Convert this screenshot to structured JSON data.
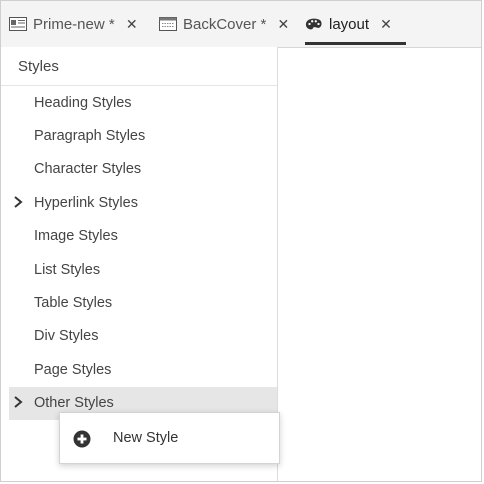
{
  "tabs": [
    {
      "label": "Prime-new *",
      "icon": "document-icon",
      "close": "✕"
    },
    {
      "label": "BackCover *",
      "icon": "page-layout-icon",
      "close": "✕"
    },
    {
      "label": "layout",
      "icon": "palette-icon",
      "close": "✕",
      "active": true
    }
  ],
  "panel": {
    "title": "Styles",
    "items": [
      {
        "label": "Heading Styles"
      },
      {
        "label": "Paragraph Styles"
      },
      {
        "label": "Character Styles"
      },
      {
        "label": "Hyperlink Styles",
        "expandable": true,
        "chevron": "›"
      },
      {
        "label": "Image Styles"
      },
      {
        "label": "List Styles"
      },
      {
        "label": "Table Styles"
      },
      {
        "label": "Div Styles"
      },
      {
        "label": "Page Styles"
      },
      {
        "label": "Other Styles",
        "expandable": true,
        "chevron": "›",
        "selected": true
      }
    ]
  },
  "context_menu": {
    "items": [
      {
        "label": "New Style",
        "icon": "plus-circle-icon"
      }
    ]
  }
}
